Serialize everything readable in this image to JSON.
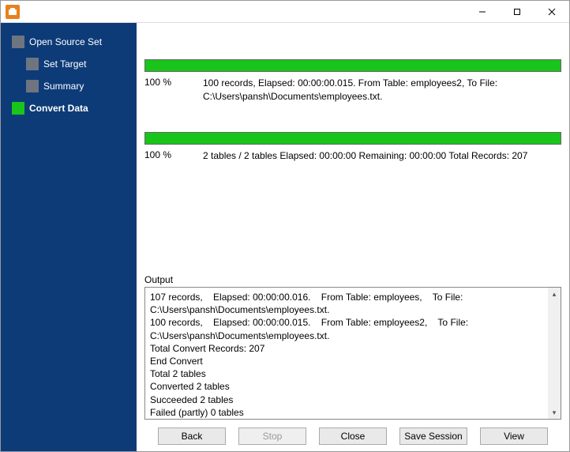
{
  "sidebar": {
    "steps": [
      {
        "label": "Open Source Set",
        "sub": false,
        "active": false
      },
      {
        "label": "Set Target",
        "sub": true,
        "active": false
      },
      {
        "label": "Summary",
        "sub": true,
        "active": false
      },
      {
        "label": "Convert Data",
        "sub": false,
        "active": true,
        "current": true
      }
    ]
  },
  "progress1": {
    "percent_label": "100 %",
    "details": "100 records,    Elapsed: 00:00:00.015.    From Table: employees2,    To File: C:\\Users\\pansh\\Documents\\employees.txt."
  },
  "progress2": {
    "percent_label": "100 %",
    "details": "2 tables / 2 tables    Elapsed: 00:00:00    Remaining: 00:00:00    Total Records: 207"
  },
  "output": {
    "label": "Output",
    "text": "107 records,    Elapsed: 00:00:00.016.    From Table: employees,    To File: C:\\Users\\pansh\\Documents\\employees.txt.\n100 records,    Elapsed: 00:00:00.015.    From Table: employees2,    To File: C:\\Users\\pansh\\Documents\\employees.txt.\nTotal Convert Records: 207\nEnd Convert\nTotal 2 tables\nConverted 2 tables\nSucceeded 2 tables\nFailed (partly) 0 tables"
  },
  "buttons": {
    "back": "Back",
    "stop": "Stop",
    "close": "Close",
    "save_session": "Save Session",
    "view": "View"
  }
}
